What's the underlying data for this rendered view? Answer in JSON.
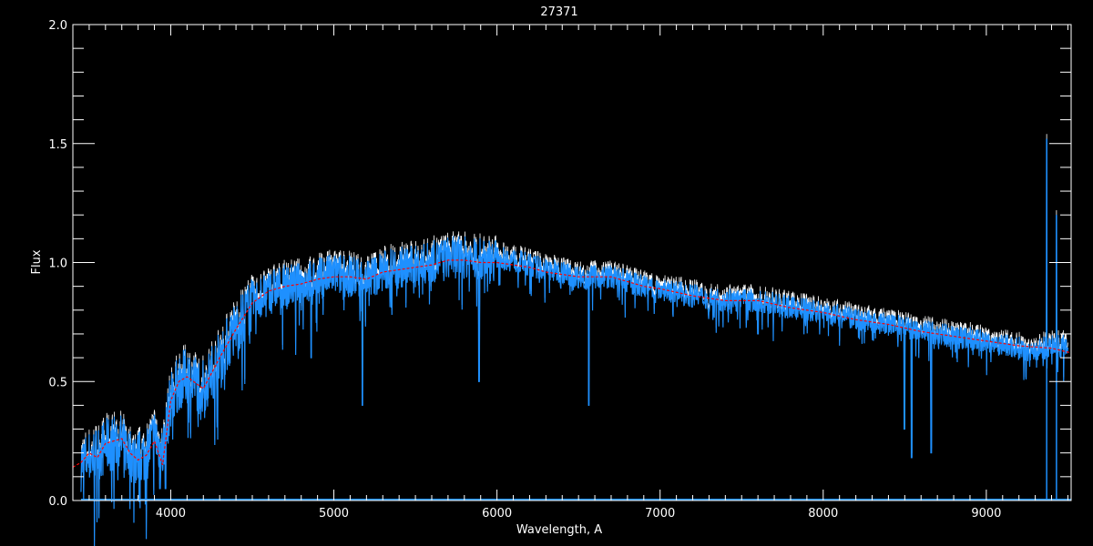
{
  "chart_data": {
    "type": "line",
    "title": "27371",
    "xlabel": "Wavelength, A",
    "ylabel": "Flux",
    "xlim": [
      3400,
      9520
    ],
    "ylim": [
      0,
      2.0
    ],
    "xticks": [
      "4000",
      "5000",
      "6000",
      "7000",
      "8000",
      "9000"
    ],
    "yticks": [
      "0.0",
      "0.5",
      "1.0",
      "1.5",
      "2.0"
    ],
    "grid": false,
    "series": [
      {
        "color": "#1e90ff",
        "x": [
          3450,
          3500,
          3550,
          3600,
          3650,
          3700,
          3750,
          3800,
          3850,
          3900,
          3950,
          4000,
          4050,
          4100,
          4200,
          4300,
          4400,
          4500,
          4600,
          4700,
          4800,
          4900,
          5000,
          5100,
          5200,
          5300,
          5400,
          5500,
          5600,
          5700,
          5800,
          5900,
          6000,
          6100,
          6200,
          6300,
          6400,
          6500,
          6600,
          6700,
          6800,
          6900,
          7000,
          7200,
          7400,
          7600,
          7800,
          8000,
          8200,
          8400,
          8600,
          8800,
          9000,
          9200,
          9300,
          9400,
          9500
        ],
        "y": [
          0.18,
          0.2,
          0.22,
          0.25,
          0.27,
          0.27,
          0.22,
          0.2,
          0.22,
          0.3,
          0.22,
          0.45,
          0.52,
          0.55,
          0.5,
          0.62,
          0.75,
          0.85,
          0.9,
          0.92,
          0.93,
          0.95,
          0.97,
          0.96,
          0.95,
          0.98,
          1.0,
          1.0,
          1.02,
          1.04,
          1.04,
          1.03,
          1.03,
          1.02,
          1.0,
          0.98,
          0.97,
          0.95,
          0.95,
          0.95,
          0.93,
          0.91,
          0.9,
          0.87,
          0.85,
          0.85,
          0.82,
          0.8,
          0.77,
          0.75,
          0.72,
          0.7,
          0.68,
          0.65,
          0.64,
          0.66,
          0.66
        ],
        "lines": [
          {
            "x": 3934,
            "y": 0.05
          },
          {
            "x": 3968,
            "y": 0.05
          },
          {
            "x": 4861,
            "y": 0.6
          },
          {
            "x": 5175,
            "y": 0.4
          },
          {
            "x": 5890,
            "y": 0.5
          },
          {
            "x": 6563,
            "y": 0.4
          },
          {
            "x": 8498,
            "y": 0.3
          },
          {
            "x": 8542,
            "y": 0.18
          },
          {
            "x": 8662,
            "y": 0.2
          },
          {
            "x": 7600,
            "y": 0.7
          }
        ],
        "spikes": [
          {
            "x": 9370,
            "y": 1.52
          },
          {
            "x": 9430,
            "y": 1.2
          }
        ]
      },
      {
        "color": "#ff0000",
        "x": [
          3400,
          3450,
          3500,
          3550,
          3600,
          3650,
          3700,
          3750,
          3800,
          3850,
          3900,
          3950,
          4000,
          4050,
          4100,
          4200,
          4300,
          4400,
          4500,
          4600,
          4700,
          4800,
          4900,
          5000,
          5100,
          5200,
          5300,
          5400,
          5500,
          5600,
          5700,
          5800,
          5900,
          6000,
          6100,
          6200,
          6300,
          6400,
          6500,
          6600,
          6700,
          6800,
          6900,
          7000,
          7200,
          7400,
          7600,
          7800,
          8000,
          8200,
          8400,
          8600,
          8800,
          9000,
          9200,
          9400,
          9520
        ],
        "y": [
          0.14,
          0.16,
          0.2,
          0.18,
          0.24,
          0.25,
          0.26,
          0.2,
          0.17,
          0.19,
          0.25,
          0.15,
          0.42,
          0.5,
          0.52,
          0.47,
          0.6,
          0.72,
          0.83,
          0.88,
          0.9,
          0.91,
          0.93,
          0.94,
          0.94,
          0.93,
          0.96,
          0.97,
          0.98,
          0.99,
          1.01,
          1.01,
          1.0,
          1.0,
          0.99,
          0.98,
          0.96,
          0.95,
          0.94,
          0.94,
          0.94,
          0.92,
          0.9,
          0.89,
          0.86,
          0.84,
          0.84,
          0.81,
          0.79,
          0.76,
          0.74,
          0.71,
          0.69,
          0.67,
          0.65,
          0.64,
          0.62
        ]
      }
    ]
  }
}
